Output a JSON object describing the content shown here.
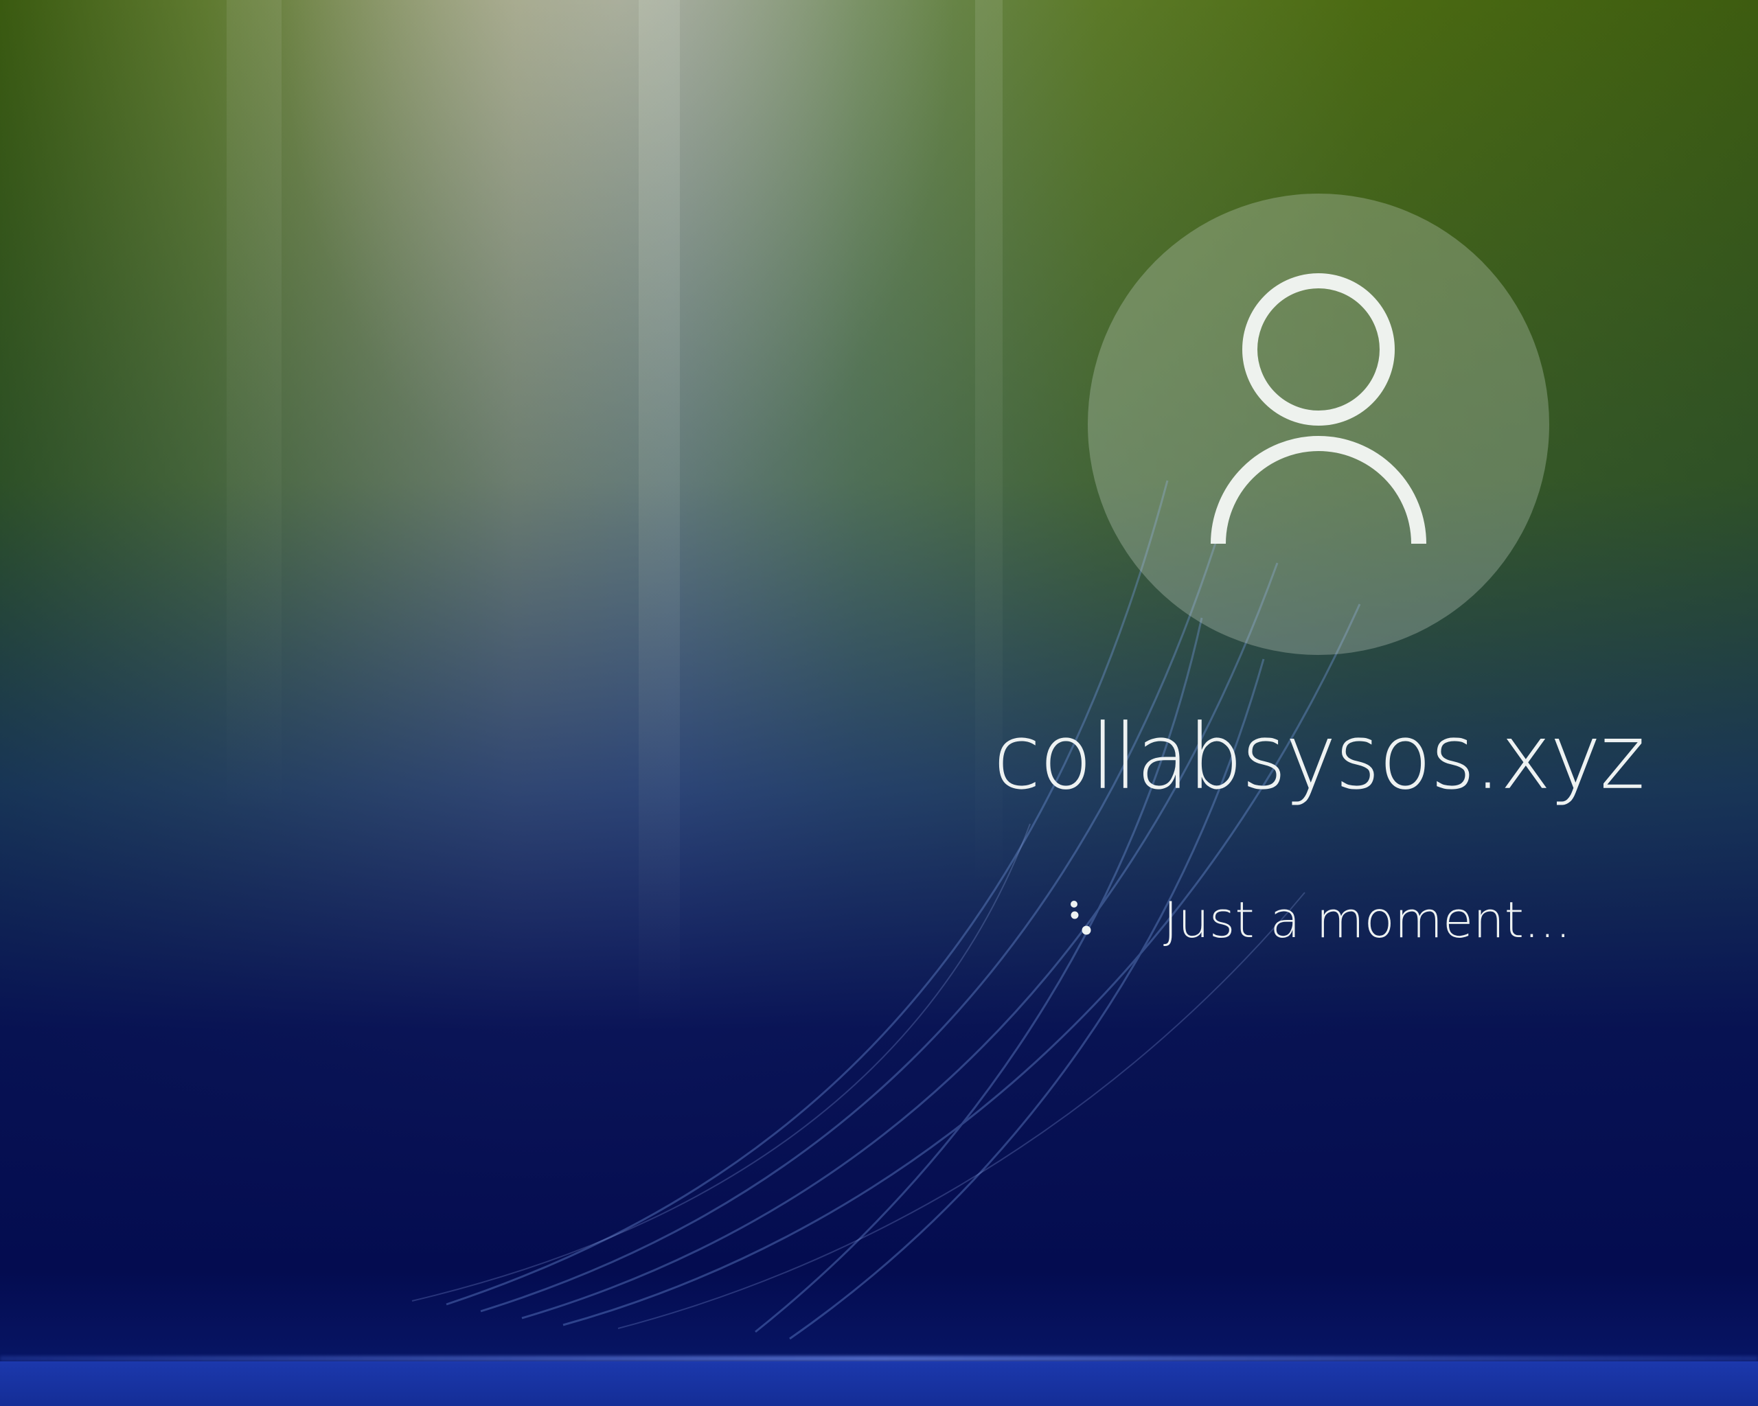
{
  "login": {
    "username": "collabsysos.xyz",
    "status_text": "Just a moment..."
  },
  "icons": {
    "avatar": "user-silhouette-icon",
    "spinner": "loading-dots-icon"
  },
  "colors": {
    "text": "#eef2f2",
    "avatar_fill": "rgba(200,210,200,0.32)",
    "background_top": "#5f7a30",
    "background_bottom": "#06127a"
  }
}
